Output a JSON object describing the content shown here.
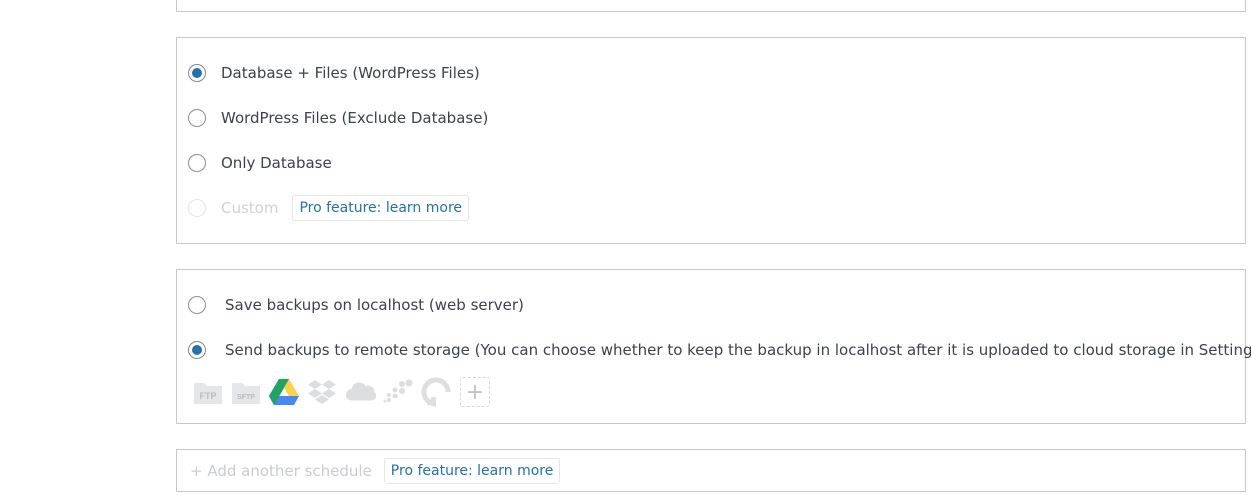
{
  "backup_content": {
    "options": [
      {
        "label": "Database + Files (WordPress Files)",
        "selected": true,
        "disabled": false
      },
      {
        "label": "WordPress Files (Exclude Database)",
        "selected": false,
        "disabled": false
      },
      {
        "label": "Only Database",
        "selected": false,
        "disabled": false
      },
      {
        "label": "Custom",
        "selected": false,
        "disabled": true
      }
    ],
    "custom_pro_link": "Pro feature: learn more"
  },
  "destination": {
    "options": [
      {
        "label": "Save backups on localhost (web server)",
        "selected": false
      },
      {
        "label": "Send backups to remote storage (You can choose whether to keep the backup in localhost after it is uploaded to cloud storage in Settings.)",
        "selected": true
      }
    ],
    "storage_icons": [
      {
        "name": "ftp-icon",
        "text": "FTP"
      },
      {
        "name": "sftp-icon",
        "text": "SFTP"
      },
      {
        "name": "google-drive-icon"
      },
      {
        "name": "dropbox-icon"
      },
      {
        "name": "onedrive-icon"
      },
      {
        "name": "amazon-s3-icon"
      },
      {
        "name": "digitalocean-spaces-icon"
      }
    ],
    "add_storage_symbol": "+"
  },
  "schedule": {
    "add_label": "+ Add another schedule",
    "pro_link": "Pro feature: learn more"
  },
  "colors": {
    "accent": "#2271b1",
    "gdrive_green": "#1fa463",
    "gdrive_yellow": "#ffd04b",
    "gdrive_blue": "#4688f4"
  }
}
